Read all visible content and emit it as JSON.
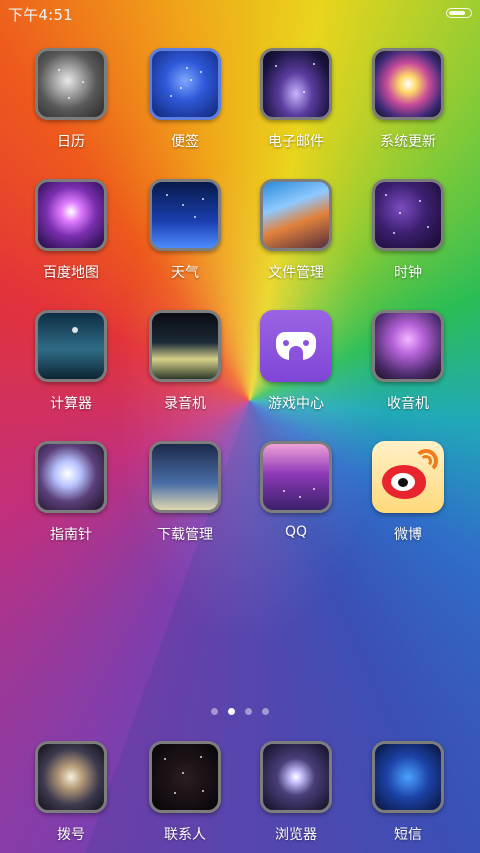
{
  "status_bar": {
    "time": "下午4:51",
    "battery_level": 0.7
  },
  "apps": [
    {
      "name": "calendar",
      "label": "日历",
      "icon": "galaxy-grey"
    },
    {
      "name": "notes",
      "label": "便签",
      "icon": "blue-stars"
    },
    {
      "name": "email",
      "label": "电子邮件",
      "icon": "nebula-purple"
    },
    {
      "name": "system-update",
      "label": "系统更新",
      "icon": "burst"
    },
    {
      "name": "baidu-maps",
      "label": "百度地图",
      "icon": "ring"
    },
    {
      "name": "weather",
      "label": "天气",
      "icon": "blue-lines"
    },
    {
      "name": "file-manager",
      "label": "文件管理",
      "icon": "sunset"
    },
    {
      "name": "clock",
      "label": "时钟",
      "icon": "stars-purple"
    },
    {
      "name": "calculator",
      "label": "计算器",
      "icon": "night-lake"
    },
    {
      "name": "recorder",
      "label": "录音机",
      "icon": "planet"
    },
    {
      "name": "game-center",
      "label": "游戏中心",
      "icon": "gamepad"
    },
    {
      "name": "radio",
      "label": "收音机",
      "icon": "heart"
    },
    {
      "name": "compass",
      "label": "指南针",
      "icon": "glow-rock"
    },
    {
      "name": "download-manager",
      "label": "下载管理",
      "icon": "startrails"
    },
    {
      "name": "qq",
      "label": "QQ",
      "icon": "pink-sky"
    },
    {
      "name": "weibo",
      "label": "微博",
      "icon": "weibo"
    }
  ],
  "page_indicator": {
    "total": 4,
    "active": 2
  },
  "dock": [
    {
      "name": "phone",
      "label": "拨号",
      "icon": "spiral"
    },
    {
      "name": "contacts",
      "label": "联系人",
      "icon": "dark-stars"
    },
    {
      "name": "browser",
      "label": "浏览器",
      "icon": "cluster"
    },
    {
      "name": "messages",
      "label": "短信",
      "icon": "crescent"
    }
  ]
}
